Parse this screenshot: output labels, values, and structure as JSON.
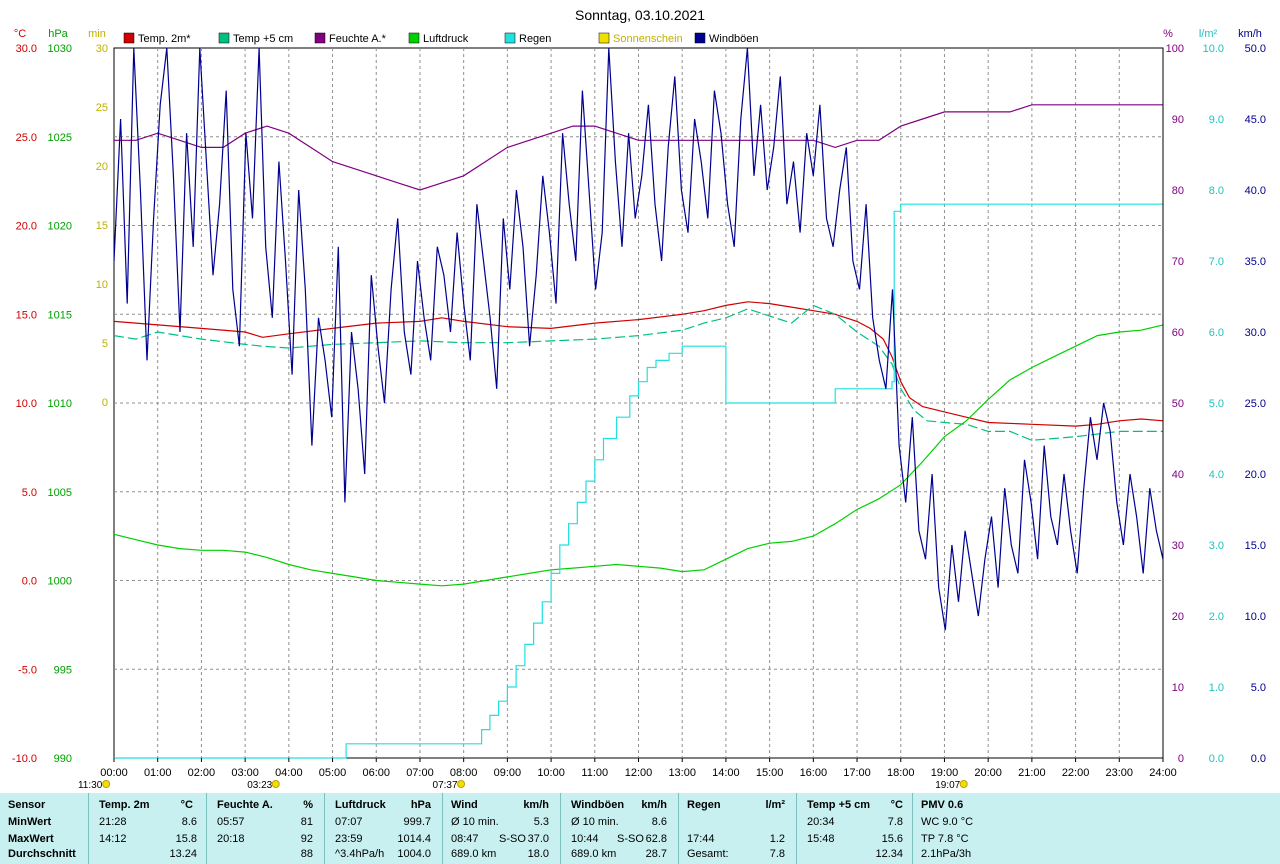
{
  "title": "Sonntag, 03.10.2021",
  "colors": {
    "temp2m": "#d00000",
    "temp5cm": "#00c080",
    "humidity": "#800080",
    "pressure": "#00d000",
    "rain": "#20e0e0",
    "sun": "#f0e000",
    "gusts": "#000090",
    "grid": "#808080"
  },
  "legend": [
    {
      "label": "Temp. 2m*",
      "color": "#d00000"
    },
    {
      "label": "Temp +5 cm",
      "color": "#00c080"
    },
    {
      "label": "Feuchte A.*",
      "color": "#800080"
    },
    {
      "label": "Luftdruck",
      "color": "#00d000"
    },
    {
      "label": "Regen",
      "color": "#20e0e0"
    },
    {
      "label": "Sonnenschein",
      "color": "#f0e000"
    },
    {
      "label": "Windböen",
      "color": "#000090"
    }
  ],
  "axes": {
    "temp_unit": "°C",
    "pressure_unit": "hPa",
    "sun_unit": "min",
    "hum_unit": "%",
    "rain_unit": "l/m²",
    "wind_unit": "km/h",
    "temp_ticks": [
      "30.0",
      "25.0",
      "20.0",
      "15.0",
      "10.0",
      "5.0",
      "0.0",
      "-5.0",
      "-10.0"
    ],
    "pressure_ticks": [
      "1030",
      "1025",
      "1020",
      "1015",
      "1010",
      "1005",
      "1000",
      "995",
      "990"
    ],
    "sun_ticks": [
      "30",
      "25",
      "20",
      "15",
      "10",
      "5",
      "0"
    ],
    "hum_ticks": [
      "100",
      "90",
      "80",
      "70",
      "60",
      "50",
      "40",
      "30",
      "20",
      "10",
      "0"
    ],
    "rain_ticks": [
      "10.0",
      "9.0",
      "8.0",
      "7.0",
      "6.0",
      "5.0",
      "4.0",
      "3.0",
      "2.0",
      "1.0",
      "0.0"
    ],
    "wind_ticks": [
      "50.0",
      "45.0",
      "40.0",
      "35.0",
      "30.0",
      "25.0",
      "20.0",
      "15.0",
      "10.0",
      "5.0",
      "0.0"
    ],
    "x_ticks": [
      "00:00",
      "01:00",
      "02:00",
      "03:00",
      "04:00",
      "05:00",
      "06:00",
      "07:00",
      "08:00",
      "09:00",
      "10:00",
      "11:00",
      "12:00",
      "13:00",
      "14:00",
      "15:00",
      "16:00",
      "17:00",
      "18:00",
      "19:00",
      "20:00",
      "21:00",
      "22:00",
      "23:00",
      "24:00"
    ]
  },
  "markers": [
    {
      "label": "11:30",
      "hour": -0.5
    },
    {
      "label": "03:23",
      "hour": 3.38
    },
    {
      "label": "07:37",
      "hour": 7.62
    },
    {
      "label": "19:07",
      "hour": 19.12
    }
  ],
  "chart_data": {
    "type": "line",
    "title": "Sonntag, 03.10.2021",
    "x_unit": "hour",
    "series": [
      {
        "name": "Temp. 2m*",
        "axis": "temp",
        "ylim": [
          -10,
          30
        ],
        "x": [
          0,
          0.5,
          1,
          2,
          3,
          3.4,
          4,
          5,
          6,
          7,
          7.5,
          8,
          9,
          10,
          11,
          12,
          13,
          13.5,
          14,
          14.5,
          15,
          15.5,
          16,
          16.5,
          17,
          17.3,
          17.6,
          17.8,
          18,
          18.2,
          18.5,
          19,
          19.5,
          20,
          21,
          22,
          22.5,
          23,
          23.5,
          24
        ],
        "y": [
          14.6,
          14.5,
          14.4,
          14.2,
          14.0,
          13.7,
          13.9,
          14.2,
          14.5,
          14.6,
          14.8,
          14.6,
          14.3,
          14.2,
          14.5,
          14.7,
          15.0,
          15.2,
          15.5,
          15.7,
          15.6,
          15.4,
          15.2,
          15.0,
          14.6,
          14.2,
          13.6,
          12.6,
          11.2,
          10.3,
          9.8,
          9.5,
          9.2,
          8.9,
          8.8,
          8.7,
          8.8,
          9.0,
          9.1,
          9.0
        ]
      },
      {
        "name": "Temp +5 cm",
        "axis": "temp",
        "ylim": [
          -10,
          30
        ],
        "x": [
          0,
          0.5,
          1,
          2,
          3,
          3.4,
          4,
          5,
          6,
          7,
          8,
          9,
          10,
          11,
          12,
          13,
          13.5,
          14,
          14.5,
          15,
          15.5,
          16,
          16.5,
          17,
          17.5,
          17.8,
          18,
          18.3,
          18.6,
          19,
          19.5,
          20,
          20.5,
          21,
          22,
          23,
          24
        ],
        "y": [
          13.8,
          13.6,
          14.0,
          13.6,
          13.3,
          13.2,
          13.1,
          13.3,
          13.4,
          13.5,
          13.4,
          13.4,
          13.5,
          13.6,
          13.8,
          14.1,
          14.5,
          14.8,
          15.3,
          14.9,
          14.5,
          15.5,
          15.0,
          14.0,
          13.2,
          12.2,
          10.8,
          9.6,
          9.0,
          8.9,
          8.8,
          8.4,
          8.4,
          7.9,
          8.1,
          8.4,
          8.4
        ]
      },
      {
        "name": "Feuchte A.*",
        "axis": "humidity",
        "ylim": [
          0,
          100
        ],
        "x": [
          0,
          0.5,
          1,
          1.5,
          2,
          2.5,
          3,
          3.5,
          4,
          4.5,
          5,
          5.5,
          6,
          6.5,
          7,
          7.5,
          8,
          8.5,
          9,
          9.5,
          10,
          10.5,
          11,
          11.5,
          12,
          12.5,
          13,
          13.5,
          14,
          14.5,
          15,
          15.5,
          16,
          16.5,
          17,
          17.5,
          18,
          18.5,
          19,
          19.5,
          20,
          20.5,
          21,
          21.5,
          22,
          23,
          24
        ],
        "y": [
          87,
          87,
          88,
          87,
          86,
          86,
          88,
          89,
          88,
          86,
          84,
          83,
          82,
          81,
          80,
          81,
          82,
          84,
          86,
          87,
          88,
          89,
          89,
          88,
          87,
          87,
          87,
          87,
          87,
          87,
          87,
          87,
          87,
          86,
          87,
          87,
          89,
          90,
          91,
          91,
          91,
          91,
          92,
          92,
          92,
          92,
          92
        ]
      },
      {
        "name": "Luftdruck",
        "axis": "pressure",
        "ylim": [
          990,
          1030
        ],
        "x": [
          0,
          0.5,
          1,
          1.5,
          2,
          2.5,
          3,
          3.5,
          4,
          4.5,
          5,
          5.5,
          6,
          6.5,
          7,
          7.5,
          8,
          8.5,
          9,
          9.5,
          10,
          10.5,
          11,
          11.5,
          12,
          12.5,
          13,
          13.5,
          14,
          14.5,
          15,
          15.5,
          16,
          16.5,
          17,
          17.5,
          18,
          18.5,
          19,
          19.5,
          20,
          20.5,
          21,
          21.5,
          22,
          22.5,
          23,
          23.5,
          24
        ],
        "y": [
          1002.6,
          1002.3,
          1002.0,
          1001.8,
          1001.7,
          1001.7,
          1001.6,
          1001.3,
          1000.9,
          1000.6,
          1000.4,
          1000.2,
          1000.0,
          999.9,
          999.8,
          999.7,
          999.8,
          1000.0,
          1000.2,
          1000.4,
          1000.6,
          1000.7,
          1000.8,
          1000.9,
          1000.8,
          1000.7,
          1000.5,
          1000.6,
          1001.2,
          1001.8,
          1002.1,
          1002.2,
          1002.5,
          1003.2,
          1004.0,
          1004.6,
          1005.4,
          1006.7,
          1008.1,
          1009.0,
          1010.2,
          1011.3,
          1012.0,
          1012.6,
          1013.2,
          1013.8,
          1014.0,
          1014.1,
          1014.4
        ]
      },
      {
        "name": "Regen",
        "axis": "rain",
        "ylim": [
          0,
          10
        ],
        "x": [
          0,
          5.3,
          5.31,
          8.4,
          8.41,
          8.6,
          8.8,
          9.0,
          9.2,
          9.4,
          9.6,
          9.8,
          10.0,
          10.2,
          10.4,
          10.6,
          10.8,
          11.0,
          11.2,
          11.5,
          11.8,
          12.0,
          12.2,
          12.4,
          12.7,
          13.0,
          13.5,
          13.9,
          14.0,
          15.5,
          16.0,
          16.5,
          17.0,
          17.5,
          17.8,
          17.85,
          18.0,
          19,
          20,
          21,
          22,
          23,
          24
        ],
        "y": [
          0,
          0,
          0.2,
          0.2,
          0.4,
          0.6,
          0.8,
          1.0,
          1.3,
          1.6,
          1.9,
          2.2,
          2.6,
          3.0,
          3.3,
          3.6,
          3.9,
          4.2,
          4.5,
          4.8,
          5.1,
          5.3,
          5.5,
          5.6,
          5.7,
          5.8,
          5.8,
          5.8,
          5.0,
          5.0,
          5.0,
          5.2,
          5.2,
          5.2,
          5.3,
          7.7,
          7.8,
          7.8,
          7.8,
          7.8,
          7.8,
          7.8,
          7.8
        ]
      },
      {
        "name": "Windböen",
        "axis": "wind",
        "ylim": [
          0,
          50
        ],
        "x_start": 0,
        "x_end": 24,
        "values": [
          35,
          45,
          32,
          50,
          40,
          28,
          38,
          46,
          50,
          41,
          30,
          44,
          36,
          50,
          42,
          34,
          39,
          47,
          33,
          29,
          44,
          38,
          50,
          36,
          31,
          42,
          35,
          27,
          40,
          33,
          22,
          31,
          28,
          24,
          36,
          18,
          30,
          26,
          20,
          34,
          29,
          25,
          33,
          38,
          30,
          27,
          35,
          31,
          28,
          36,
          34,
          30,
          37,
          32,
          28,
          39,
          35,
          31,
          26,
          38,
          33,
          40,
          36,
          29,
          34,
          41,
          37,
          32,
          44,
          39,
          35,
          47,
          40,
          33,
          37,
          50,
          42,
          36,
          44,
          38,
          41,
          46,
          39,
          35,
          43,
          48,
          40,
          37,
          45,
          42,
          38,
          47,
          44,
          39,
          36,
          45,
          50,
          41,
          46,
          40,
          43,
          48,
          39,
          42,
          37,
          44,
          41,
          46,
          38,
          36,
          40,
          43,
          35,
          33,
          39,
          31,
          28,
          26,
          33,
          22,
          18,
          24,
          16,
          14,
          20,
          12,
          9,
          15,
          11,
          16,
          13,
          10,
          14,
          17,
          12,
          19,
          15,
          13,
          21,
          18,
          14,
          22,
          17,
          15,
          20,
          16,
          13,
          19,
          24,
          21,
          25,
          23,
          18,
          15,
          20,
          17,
          13,
          19,
          16,
          14
        ]
      }
    ],
    "sun_events": [
      7.62,
      19.12
    ]
  },
  "stats": {
    "row_labels": [
      "Sensor",
      "MinWert",
      "MaxWert",
      "Durchschnitt"
    ],
    "columns": [
      {
        "title": "Temp. 2m",
        "unit": "°C",
        "min_time": "21:28",
        "min_val": "8.6",
        "max_time": "14:12",
        "max_val": "15.8",
        "avg_time": "",
        "avg_val": "13.24"
      },
      {
        "title": "Feuchte A.",
        "unit": "%",
        "min_time": "05:57",
        "min_val": "81",
        "max_time": "20:18",
        "max_val": "92",
        "avg_time": "",
        "avg_val": "88"
      },
      {
        "title": "Luftdruck",
        "unit": "hPa",
        "min_time": "07:07",
        "min_val": "999.7",
        "max_time": "23:59",
        "max_val": "1014.4",
        "avg_time": "^3.4hPa/h",
        "avg_val": "1004.0"
      },
      {
        "title": "Wind",
        "unit": "km/h",
        "min_time": "Ø 10 min.",
        "min_val": "5.3",
        "max_time": "08:47",
        "max_mid": "S-SO",
        "max_val": "37.0",
        "avg_time": "689.0 km",
        "avg_val": "18.0"
      },
      {
        "title": "Windböen",
        "unit": "km/h",
        "min_time": "Ø 10 min.",
        "min_val": "8.6",
        "max_time": "10:44",
        "max_mid": "S-SO",
        "max_val": "62.8",
        "avg_time": "689.0 km",
        "avg_val": "28.7"
      },
      {
        "title": "Regen",
        "unit": "l/m²",
        "min_time": "",
        "min_val": "",
        "max_time": "17:44",
        "max_val": "1.2",
        "avg_time": "Gesamt:",
        "avg_val": "7.8"
      },
      {
        "title": "Temp +5 cm",
        "unit": "°C",
        "min_time": "20:34",
        "min_val": "7.8",
        "max_time": "15:48",
        "max_val": "15.6",
        "avg_time": "",
        "avg_val": "12.34"
      }
    ],
    "pmv": {
      "title": "PMV 0.6",
      "wc": "WC 9.0 °C",
      "tp": "TP 7.8 °C",
      "trend": "2.1hPa/3h"
    }
  }
}
